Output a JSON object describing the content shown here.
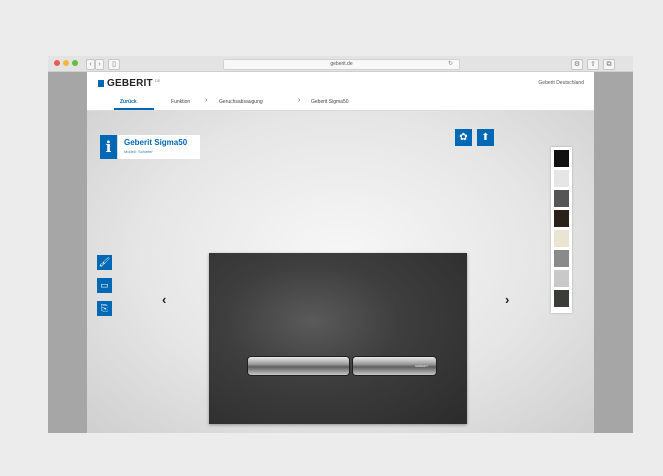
{
  "browser": {
    "url": "geberit.de",
    "nav_back": "‹",
    "nav_forward": "›",
    "sidebar_toggle": "▯",
    "reload": "↻",
    "extras": [
      "⚙",
      "⇧",
      "⧉"
    ]
  },
  "header": {
    "logo_text": "GEBERIT",
    "logo_sup": "DE",
    "country_link": "Geberit Deutschland"
  },
  "nav": {
    "back": "Zurück",
    "crumbs": [
      "Funktion",
      "Geruchsabsaugung",
      "Geberit Sigma50"
    ],
    "separator": "›"
  },
  "product": {
    "title": "Geberit Sigma50",
    "subtitle": "Modell: Schiefer",
    "info_icon": "i",
    "brand_mark": "GEBERIT"
  },
  "actions": [
    {
      "icon": "✿"
    },
    {
      "icon": "⬆"
    }
  ],
  "tools": [
    {
      "icon": "🖌"
    },
    {
      "icon": "▭"
    },
    {
      "icon": "⎘"
    }
  ],
  "arrows": {
    "prev": "‹",
    "next": "›"
  },
  "swatches": [
    {
      "color": "#111111"
    },
    {
      "color": "#e6e6e6"
    },
    {
      "color": "#555555"
    },
    {
      "color": "#2a2119"
    },
    {
      "color": "#eae4d3"
    },
    {
      "color": "#8a8a8a"
    },
    {
      "color": "#c9c9c9"
    },
    {
      "color": "#3b3d39"
    }
  ],
  "colors": {
    "accent": "#0068b4"
  }
}
